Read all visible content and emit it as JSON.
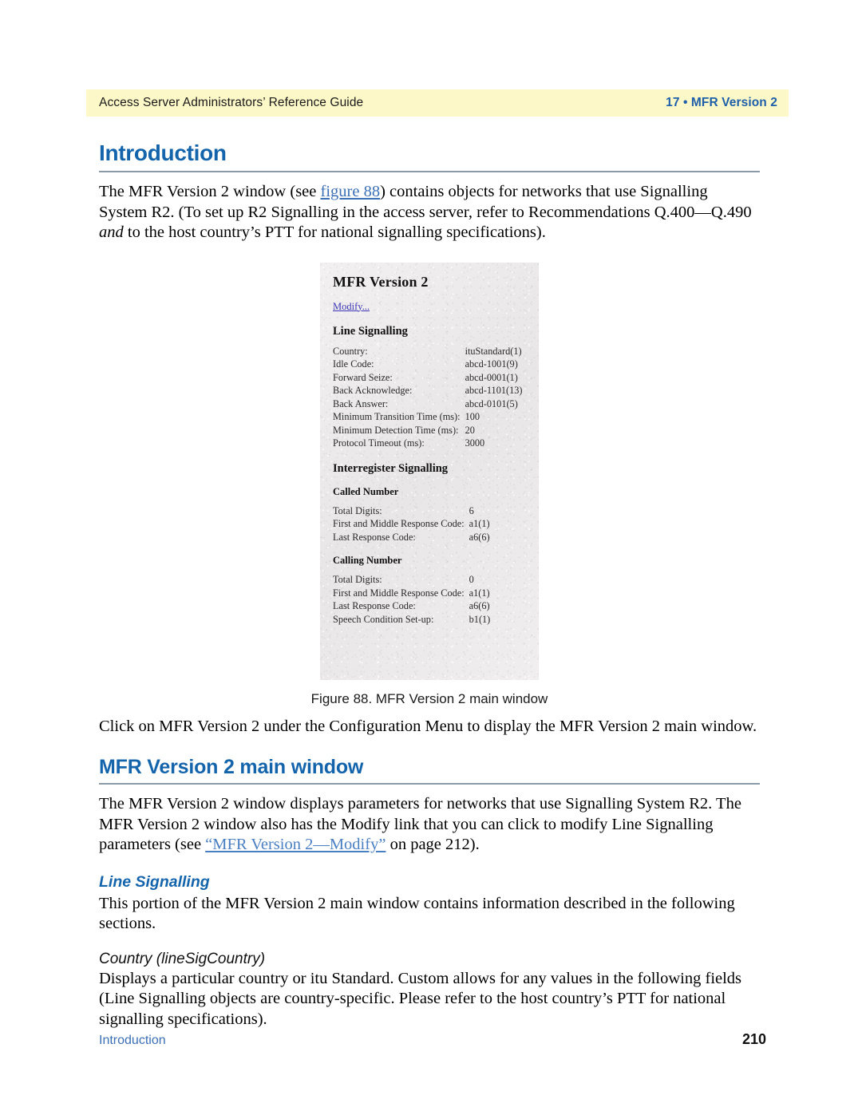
{
  "header": {
    "left": "Access Server Administrators’ Reference Guide",
    "right": "17 • MFR Version 2",
    "bg_color": "#fcf8c8",
    "accent_color": "#1f5fa9"
  },
  "intro": {
    "heading": "Introduction",
    "paragraph_pre": "The MFR Version 2 window (see ",
    "paragraph_link": "figure 88",
    "paragraph_post_a": ") contains objects for networks that use Signalling System R2. (To set up R2 Signalling in the access server, refer to Recommendations Q.400—Q.490 ",
    "paragraph_italic": "and",
    "paragraph_post_b": " to the host country’s PTT for national signalling specifications)."
  },
  "figure": {
    "caption": "Figure 88. MFR Version 2 main window",
    "window_title": "MFR Version 2",
    "modify_link": "Modify...",
    "link_color": "#3b35b5",
    "sections": [
      {
        "heading": "Line Signalling",
        "rows": [
          {
            "label": "Country:",
            "value": "ituStandard(1)"
          },
          {
            "label": "Idle Code:",
            "value": "abcd-1001(9)"
          },
          {
            "label": "Forward Seize:",
            "value": "abcd-0001(1)"
          },
          {
            "label": "Back Acknowledge:",
            "value": "abcd-1101(13)"
          },
          {
            "label": "Back Answer:",
            "value": "abcd-0101(5)"
          },
          {
            "label": "Minimum Transition Time (ms):",
            "value": "100"
          },
          {
            "label": "Minimum Detection Time (ms):",
            "value": "20"
          },
          {
            "label": "Protocol Timeout (ms):",
            "value": "3000"
          }
        ]
      },
      {
        "heading": "Interregister Signalling",
        "subsections": [
          {
            "heading": "Called Number",
            "rows": [
              {
                "label": "Total Digits:",
                "value": "6"
              },
              {
                "label": "First and Middle Response Code:",
                "value": "a1(1)"
              },
              {
                "label": "Last Response Code:",
                "value": "a6(6)"
              }
            ]
          },
          {
            "heading": "Calling Number",
            "rows": [
              {
                "label": "Total Digits:",
                "value": "0"
              },
              {
                "label": "First and Middle Response Code:",
                "value": "a1(1)"
              },
              {
                "label": "Last Response Code:",
                "value": "a6(6)"
              },
              {
                "label": "Speech Condition Set-up:",
                "value": "b1(1)"
              }
            ]
          }
        ]
      }
    ]
  },
  "after_figure": {
    "paragraph": "Click on MFR Version 2 under the Configuration Menu to display the MFR Version 2 main window."
  },
  "main_window": {
    "heading": "MFR Version 2 main window",
    "paragraph_pre": "The MFR Version 2 window displays parameters for networks that use Signalling System R2. The MFR Version 2 window also has the Modify link that you can click to modify Line Signalling parameters (see ",
    "paragraph_link": "“MFR Version 2—Modify”",
    "paragraph_post": " on page 212)."
  },
  "line_signalling": {
    "heading": "Line Signalling",
    "paragraph": "This portion of the MFR Version 2 main window contains information described in the following sections."
  },
  "country": {
    "heading": "Country (lineSigCountry)",
    "paragraph": "Displays a particular country or itu Standard. Custom allows for any values in the following fields (Line Signalling objects are country-specific. Please refer to the host country’s PTT for national signalling specifications)."
  },
  "footer": {
    "left": "Introduction",
    "right": "210"
  }
}
